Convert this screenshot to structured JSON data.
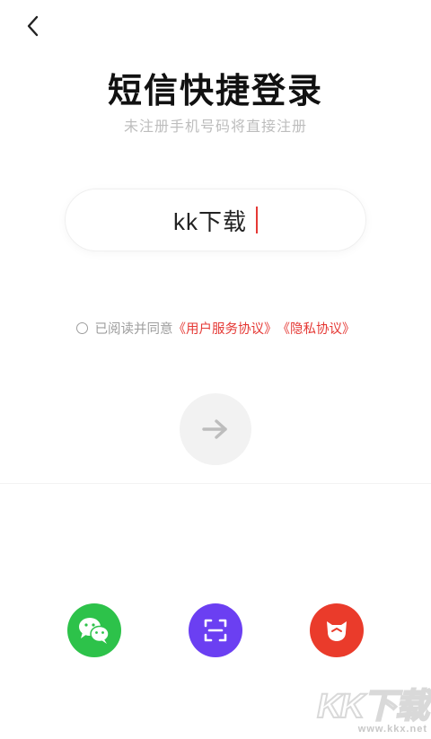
{
  "header": {
    "back_icon": "chevron-left-icon"
  },
  "title": "短信快捷登录",
  "subtitle": "未注册手机号码将直接注册",
  "phone_input": {
    "value": "kk下载"
  },
  "agreement": {
    "prefix": "已阅读并同意",
    "user_agreement": "《用户服务协议》",
    "privacy_policy": "《隐私协议》",
    "checked": false
  },
  "next_button": {
    "icon": "arrow-right-icon",
    "enabled": false
  },
  "social_login": [
    {
      "name": "wechat",
      "icon": "wechat-icon",
      "color": "#2dc24a"
    },
    {
      "name": "scan",
      "icon": "scan-icon",
      "color": "#6b3ff2"
    },
    {
      "name": "mascot",
      "icon": "cat-mascot-icon",
      "color": "#ea3b2b"
    }
  ],
  "watermark": {
    "logo": "KK下载",
    "url": "www.kkx.net"
  },
  "colors": {
    "accent": "#e53935",
    "subtle_text": "#9e9e9e"
  }
}
